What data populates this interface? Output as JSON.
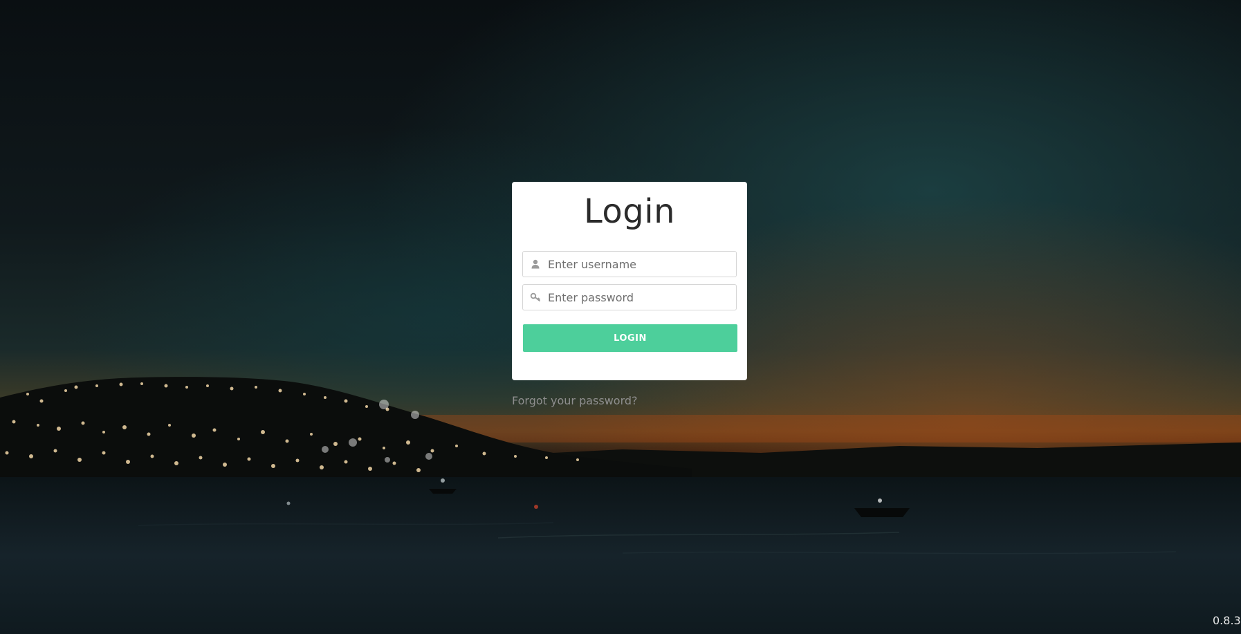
{
  "login": {
    "title": "Login",
    "username_placeholder": "Enter username",
    "password_placeholder": "Enter password",
    "button_label": "LOGIN",
    "forgot_link": "Forgot your password?"
  },
  "footer": {
    "version": "0.8.3"
  },
  "icons": {
    "username": "user-icon",
    "password": "key-icon"
  },
  "colors": {
    "accent": "#4dcf9b",
    "card": "#ffffff",
    "title": "#2b2b2b",
    "link": "#8e8e8e"
  }
}
